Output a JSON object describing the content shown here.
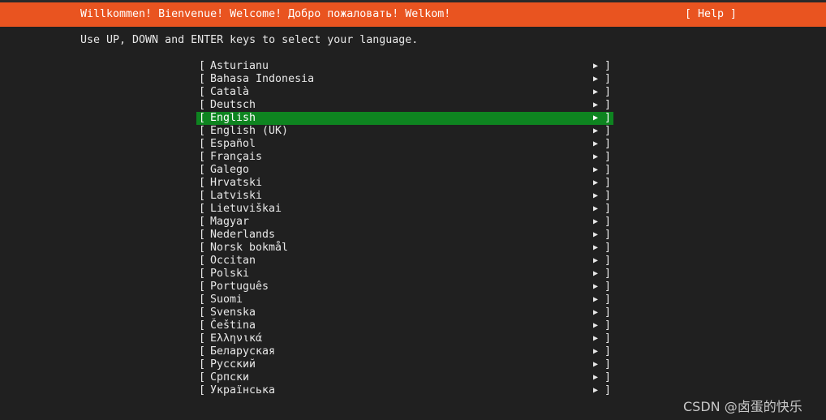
{
  "header": {
    "title": "Willkommen! Bienvenue! Welcome! Добро пожаловать! Welkom!",
    "help_label": "[ Help ]"
  },
  "instruction": "Use UP, DOWN and ENTER keys to select your language.",
  "languages": [
    "Asturianu",
    "Bahasa Indonesia",
    "Català",
    "Deutsch",
    "English",
    "English (UK)",
    "Español",
    "Français",
    "Galego",
    "Hrvatski",
    "Latviski",
    "Lietuviškai",
    "Magyar",
    "Nederlands",
    "Norsk bokmål",
    "Occitan",
    "Polski",
    "Português",
    "Suomi",
    "Svenska",
    "Čeština",
    "Ελληνικά",
    "Беларуская",
    "Русский",
    "Српски",
    "Українська"
  ],
  "selected_language": "English",
  "bracket_left": "[",
  "bracket_right": "]",
  "arrow_glyph": "▶",
  "arrow_icon_name": "right-arrow-icon",
  "colors": {
    "background": "#202020",
    "header": "#e95420",
    "selection": "#0e8420",
    "text": "#e8e8e8"
  },
  "watermark": "CSDN @卤蛋的快乐"
}
